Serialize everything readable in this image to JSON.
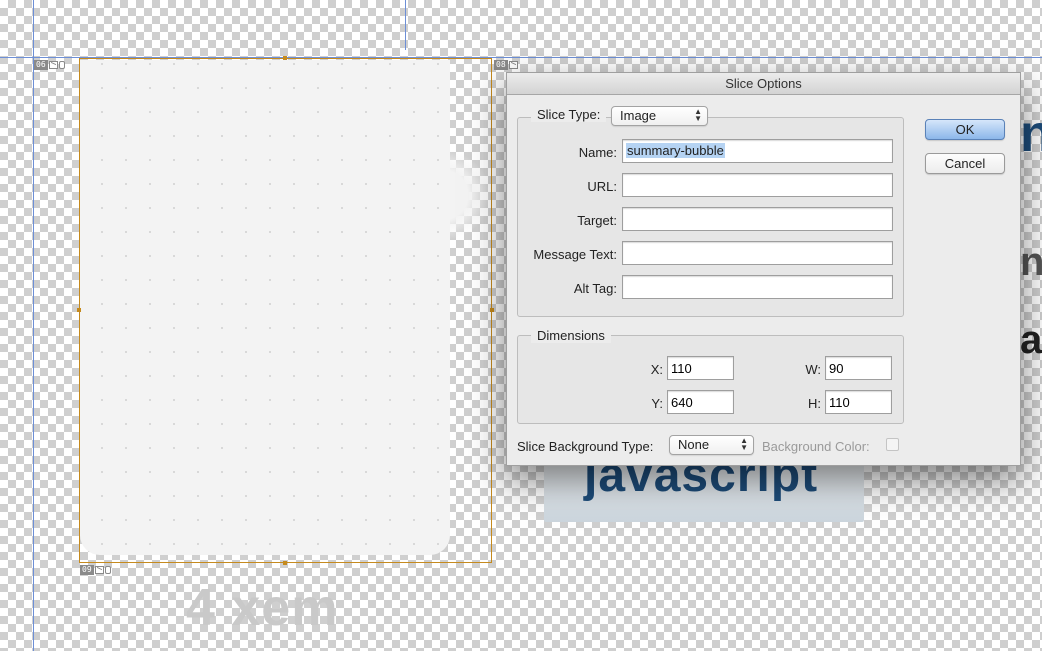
{
  "canvas": {
    "slice_tags": [
      {
        "number": "06",
        "active": false
      },
      {
        "number": "07",
        "active": true
      },
      {
        "number": "08",
        "active": false
      },
      {
        "number": "09",
        "active": false
      }
    ],
    "ghost_text": "4 xem",
    "js_button_text": "javascript",
    "peek_chars": [
      "n",
      "n",
      "ai"
    ]
  },
  "dialog": {
    "title": "Slice Options",
    "slice_type_label": "Slice Type:",
    "slice_type_value": "Image",
    "fields": {
      "name_label": "Name:",
      "name_value": "summary-bubble",
      "url_label": "URL:",
      "url_value": "",
      "target_label": "Target:",
      "target_value": "",
      "message_label": "Message Text:",
      "message_value": "",
      "alt_label": "Alt Tag:",
      "alt_value": ""
    },
    "dimensions": {
      "title": "Dimensions",
      "x_label": "X:",
      "x_value": "110",
      "y_label": "Y:",
      "y_value": "640",
      "w_label": "W:",
      "w_value": "90",
      "h_label": "H:",
      "h_value": "110"
    },
    "background": {
      "type_label": "Slice Background Type:",
      "type_value": "None",
      "color_label": "Background Color:"
    },
    "buttons": {
      "ok": "OK",
      "cancel": "Cancel"
    }
  },
  "colors": {
    "slice_border": "#c58a1e",
    "active_slice": "#1b2fd2",
    "guide": "#6d8fd6",
    "ok_button": "#8cb7ea",
    "text_selection": "#b5d3f3"
  }
}
